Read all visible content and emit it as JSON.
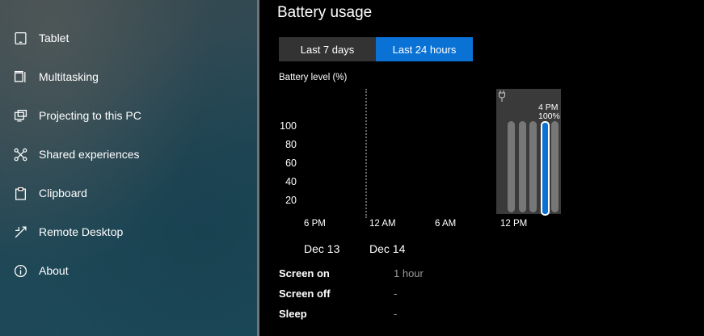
{
  "sidebar": {
    "items": [
      {
        "label": "Tablet",
        "icon": "tablet-icon"
      },
      {
        "label": "Multitasking",
        "icon": "multitasking-icon"
      },
      {
        "label": "Projecting to this PC",
        "icon": "projecting-icon"
      },
      {
        "label": "Shared experiences",
        "icon": "shared-experiences-icon"
      },
      {
        "label": "Clipboard",
        "icon": "clipboard-icon"
      },
      {
        "label": "Remote Desktop",
        "icon": "remote-desktop-icon"
      },
      {
        "label": "About",
        "icon": "info-icon"
      }
    ]
  },
  "main": {
    "title": "Battery usage",
    "tabs": [
      {
        "label": "Last 7 days",
        "selected": false
      },
      {
        "label": "Last 24 hours",
        "selected": true
      }
    ],
    "accent": "#0a72d4"
  },
  "chart_data": {
    "type": "bar",
    "ylabel": "Battery level (%)",
    "y_ticks": [
      "100",
      "80",
      "60",
      "40",
      "20"
    ],
    "ylim": [
      0,
      100
    ],
    "x_ticks": [
      "6 PM",
      "12 AM",
      "6 AM",
      "12 PM"
    ],
    "dates": [
      "Dec 13",
      "Dec 14"
    ],
    "values": [
      100,
      100,
      100,
      100,
      100
    ],
    "selected_index": 3,
    "selected_label": {
      "time": "4 PM",
      "value": "100%"
    },
    "plugged_in_icon": "plug-icon"
  },
  "stats": [
    {
      "label": "Screen on",
      "value": "1 hour"
    },
    {
      "label": "Screen off",
      "value": "-"
    },
    {
      "label": "Sleep",
      "value": "-"
    }
  ]
}
